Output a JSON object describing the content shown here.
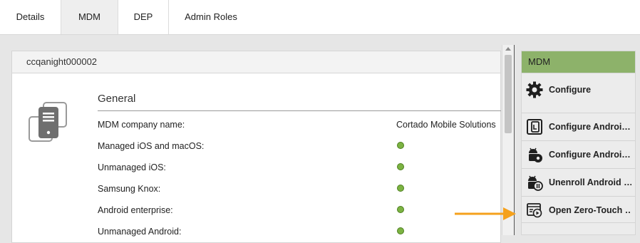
{
  "tabs": [
    {
      "label": "Details"
    },
    {
      "label": "MDM"
    },
    {
      "label": "DEP"
    },
    {
      "label": "Admin Roles"
    }
  ],
  "panel": {
    "device_name": "ccqanight000002",
    "section_title": "General",
    "rows": [
      {
        "label": "MDM company name:",
        "value": "Cortado Mobile Solutions"
      },
      {
        "label": "Managed iOS and macOS:",
        "status": "green"
      },
      {
        "label": "Unmanaged iOS:",
        "status": "green"
      },
      {
        "label": "Samsung Knox:",
        "status": "green"
      },
      {
        "label": "Android enterprise:",
        "status": "green"
      },
      {
        "label": "Unmanaged Android:",
        "status": "green"
      }
    ]
  },
  "sidepanel": {
    "title": "MDM",
    "actions": [
      {
        "label": "Configure",
        "icon": "gear-icon"
      },
      {
        "label": "Configure Androi…",
        "icon": "android-settings-icon"
      },
      {
        "label": "Configure Androi…",
        "icon": "android-gear-icon"
      },
      {
        "label": "Unenroll Android …",
        "icon": "android-pause-icon"
      },
      {
        "label": "Open Zero-Touch …",
        "icon": "open-window-icon"
      }
    ]
  },
  "colors": {
    "accent_green": "#8db26a",
    "status_green": "#7cb342",
    "arrow_orange": "#f5a11c"
  }
}
